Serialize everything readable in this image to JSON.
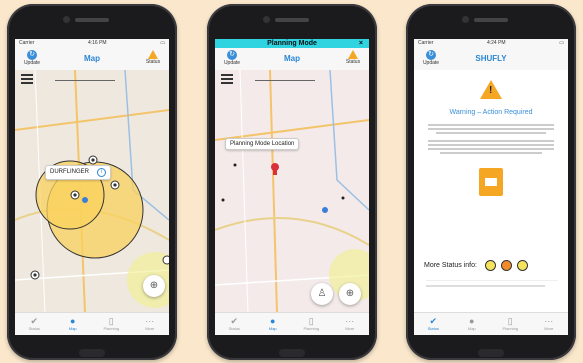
{
  "background_color": "#fbe8cc",
  "phones": [
    {
      "status_left": "Carrier",
      "status_time": "4:16 PM",
      "nav": {
        "update_label": "Update",
        "title": "Map",
        "status_label": "Status"
      },
      "callout": "DURFLINGER",
      "tabs": [
        "Status",
        "Map",
        "Planning",
        "More"
      ]
    },
    {
      "mode_banner": "Planning Mode",
      "mode_close": "×",
      "nav": {
        "update_label": "Update",
        "title": "Map",
        "status_label": "Status"
      },
      "callout": "Planning Mode Location",
      "tabs": [
        "Status",
        "Map",
        "Planning",
        "More"
      ]
    },
    {
      "status_left": "Carrier",
      "status_time": "4:24 PM",
      "nav": {
        "update_label": "Update",
        "title": "SHUFLY"
      },
      "warning_title": "Warning – Action Required",
      "more_status_label": "More Status info:",
      "tabs": [
        "Status",
        "Map",
        "Planning",
        "More"
      ]
    }
  ],
  "icons": {
    "update": "refresh-icon",
    "status": "warning-triangle-icon",
    "locate": "crosshair-icon",
    "person": "person-icon"
  }
}
